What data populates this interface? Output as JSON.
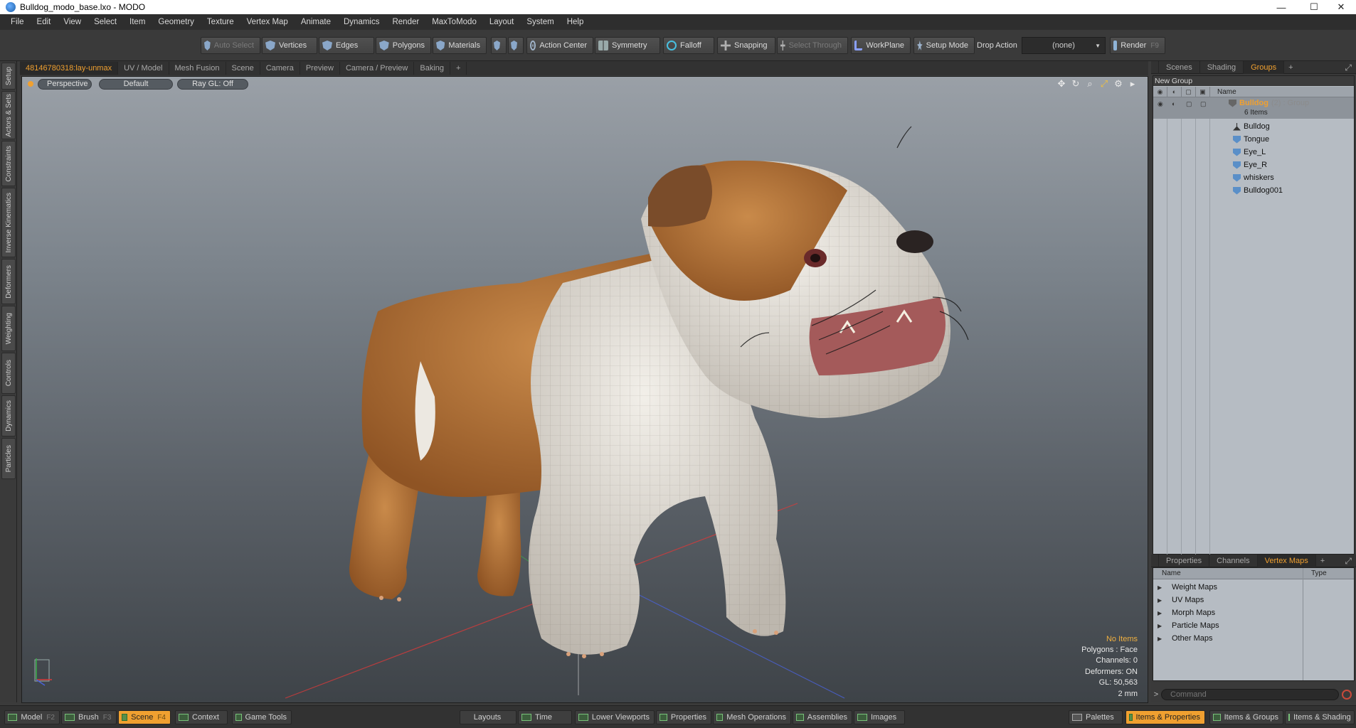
{
  "window": {
    "title": "Bulldog_modo_base.lxo - MODO",
    "minimize": "—",
    "maximize": "☐",
    "close": "✕"
  },
  "menu": [
    "File",
    "Edit",
    "View",
    "Select",
    "Item",
    "Geometry",
    "Texture",
    "Vertex Map",
    "Animate",
    "Dynamics",
    "Render",
    "MaxToModo",
    "Layout",
    "System",
    "Help"
  ],
  "toolbar": {
    "auto_select": "Auto Select",
    "vertices": "Vertices",
    "edges": "Edges",
    "polygons": "Polygons",
    "materials": "Materials",
    "action_center": "Action Center",
    "symmetry": "Symmetry",
    "falloff": "Falloff",
    "snapping": "Snapping",
    "select_through": "Select Through",
    "workplane": "WorkPlane",
    "setup_mode": "Setup Mode",
    "drop_action_label": "Drop Action",
    "drop_action_value": "(none)",
    "render": "Render",
    "render_key": "F9"
  },
  "left_tabs": [
    "Setup",
    "Actors & Sets",
    "Constraints",
    "Inverse Kinematics",
    "Deformers",
    "Weighting",
    "Controls",
    "Dynamics",
    "Particles"
  ],
  "viewport_tabs": [
    "48146780318:lay-unmax",
    "UV / Model",
    "Mesh Fusion",
    "Scene",
    "Camera",
    "Preview",
    "Camera / Preview",
    "Baking",
    "+"
  ],
  "viewport": {
    "perspective": "Perspective",
    "shading": "Default",
    "raygl": "Ray GL: Off",
    "stats": {
      "selection": "No Items",
      "polygons": "Polygons : Face",
      "channels": "Channels: 0",
      "deformers": "Deformers: ON",
      "gl": "GL: 50,563",
      "unit": "2 mm"
    },
    "colors": {
      "fur_orange": "#b8702e",
      "fur_white": "#e7e3dc",
      "axis_red": "#d83a3a",
      "axis_blue": "#4a62d8",
      "axis_green": "#3ab04a"
    }
  },
  "groups_panel": {
    "tabs": [
      "Scenes",
      "Shading",
      "Groups"
    ],
    "new_group": "New Group",
    "name_header": "Name",
    "group": {
      "name": "Bulldog",
      "suffix": "(2) : Group",
      "count": "6 Items"
    },
    "items": [
      "Bulldog",
      "Tongue",
      "Eye_L",
      "Eye_R",
      "whiskers",
      "Bulldog001"
    ]
  },
  "vmap_panel": {
    "tabs": [
      "Properties",
      "Channels",
      "Vertex Maps"
    ],
    "name_header": "Name",
    "type_header": "Type",
    "items": [
      "Weight Maps",
      "UV Maps",
      "Morph Maps",
      "Particle Maps",
      "Other Maps"
    ]
  },
  "command": {
    "caret": ">",
    "placeholder": "Command"
  },
  "bottom_bar": [
    {
      "label": "Model",
      "key": "F2"
    },
    {
      "label": "Brush",
      "key": "F3"
    },
    {
      "label": "Scene",
      "key": "F4"
    },
    {
      "label": "Context",
      "key": ""
    },
    {
      "label": "Game Tools",
      "key": ""
    },
    {
      "label": "Layouts",
      "key": ""
    },
    {
      "label": "Time",
      "key": ""
    },
    {
      "label": "Lower Viewports",
      "key": ""
    },
    {
      "label": "Properties",
      "key": ""
    },
    {
      "label": "Mesh Operations",
      "key": ""
    },
    {
      "label": "Assemblies",
      "key": ""
    },
    {
      "label": "Images",
      "key": ""
    },
    {
      "label": "Palettes",
      "key": ""
    },
    {
      "label": "Items & Properties",
      "key": ""
    },
    {
      "label": "Items & Groups",
      "key": ""
    },
    {
      "label": "Items & Shading",
      "key": ""
    }
  ]
}
